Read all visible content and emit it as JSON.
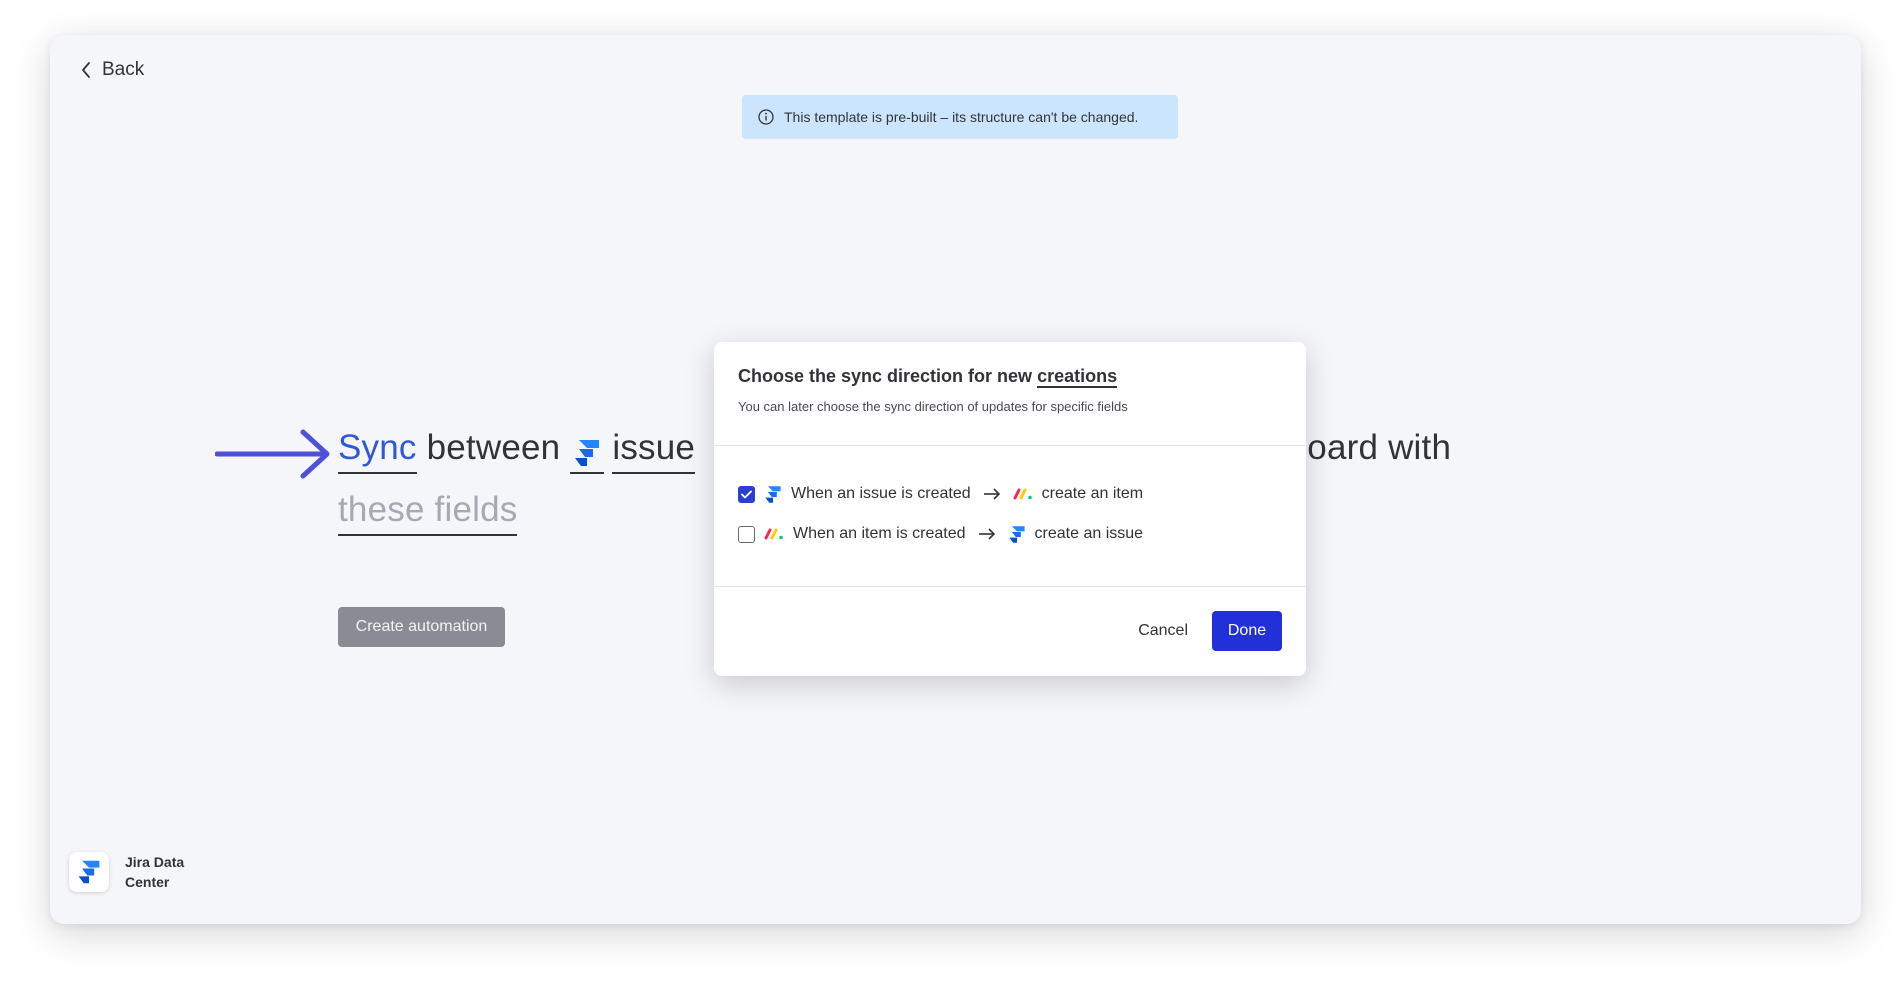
{
  "nav": {
    "back_label": "Back"
  },
  "banner": {
    "text": "This template is pre-built – its structure can't be changed.",
    "icon": "info-icon"
  },
  "sentence": {
    "word_sync": "Sync",
    "word_between": "between",
    "word_issue": "issue",
    "word_tail": "s board with",
    "word_fields": "these fields"
  },
  "actions": {
    "create_label": "Create automation"
  },
  "app": {
    "name": "Jira Data Center",
    "icon": "jira-logo-icon"
  },
  "modal": {
    "title_prefix": "Choose the sync direction for new",
    "title_highlight": "creations",
    "subtitle": "You can later choose the sync direction of updates for specific fields",
    "options": [
      {
        "checked": true,
        "trigger": "When an issue is created",
        "action": "create an item"
      },
      {
        "checked": false,
        "trigger": "When an item is created",
        "action": "create an issue"
      }
    ],
    "cancel_label": "Cancel",
    "done_label": "Done"
  },
  "colors": {
    "accent": "#2130d8",
    "sync_word": "#3159d4",
    "arrow": "#4f4fd8",
    "banner_bg": "#cce5ff"
  }
}
